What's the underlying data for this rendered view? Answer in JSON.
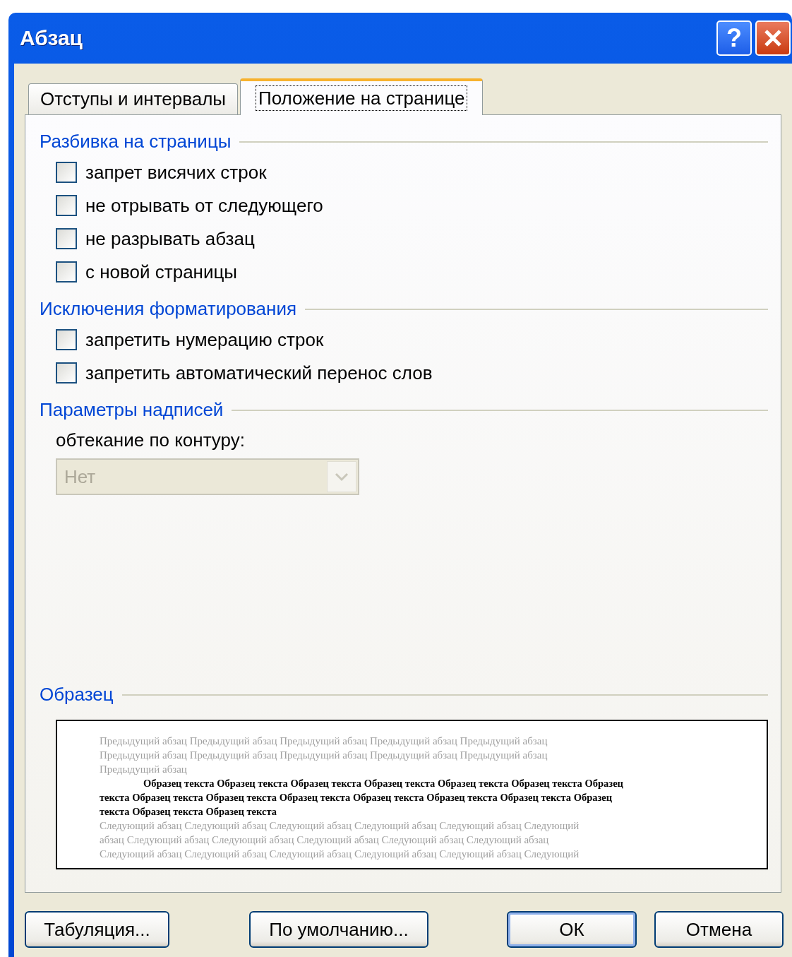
{
  "window": {
    "title": "Абзац",
    "help_button": "?"
  },
  "tabs": [
    {
      "label": "Отступы и интервалы",
      "selected": false
    },
    {
      "label": "Положение на странице",
      "selected": true
    }
  ],
  "sections": [
    {
      "kind": "checkboxes",
      "title": "Разбивка на страницы",
      "items": [
        {
          "label": "запрет висячих строк",
          "checked": false
        },
        {
          "label": "не отрывать от следующего",
          "checked": false
        },
        {
          "label": "не разрывать абзац",
          "checked": false
        },
        {
          "label": "с новой страницы",
          "checked": false
        }
      ]
    },
    {
      "kind": "checkboxes",
      "title": "Исключения форматирования",
      "items": [
        {
          "label": "запретить нумерацию строк",
          "checked": false
        },
        {
          "label": "запретить автоматический перенос слов",
          "checked": false
        }
      ]
    },
    {
      "kind": "dropdown",
      "title": "Параметры надписей",
      "field_label": "обтекание по контуру:",
      "value": "Нет",
      "disabled": true
    }
  ],
  "preview": {
    "title": "Образец",
    "paragraphs": [
      {
        "kind": "previous",
        "lines": [
          "Предыдущий абзац Предыдущий абзац Предыдущий абзац Предыдущий абзац Предыдущий абзац",
          "Предыдущий абзац Предыдущий абзац Предыдущий абзац Предыдущий абзац Предыдущий абзац",
          "Предыдущий абзац"
        ]
      },
      {
        "kind": "sample",
        "lines": [
          "Образец текста Образец текста Образец текста Образец текста Образец текста Образец текста Образец",
          "текста Образец текста Образец текста Образец текста Образец текста Образец текста Образец текста Образец",
          "текста Образец текста Образец текста"
        ]
      },
      {
        "kind": "next",
        "lines": [
          "Следующий абзац Следующий абзац Следующий абзац Следующий абзац Следующий абзац Следующий",
          "абзац Следующий абзац Следующий абзац Следующий абзац Следующий абзац Следующий абзац",
          "Следующий абзац Следующий абзац Следующий абзац Следующий абзац Следующий абзац Следующий"
        ]
      }
    ]
  },
  "buttons": [
    {
      "label": "Табуляция...",
      "default": false
    },
    {
      "label": "По умолчанию...",
      "default": false
    },
    {
      "label": "ОК",
      "default": true
    },
    {
      "label": "Отмена",
      "default": false
    }
  ]
}
